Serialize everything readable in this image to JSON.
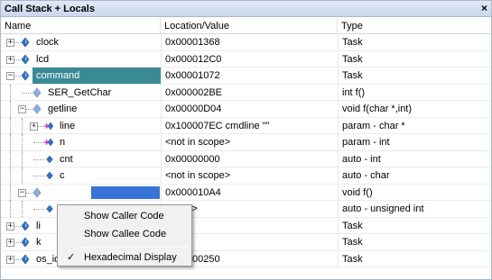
{
  "window": {
    "title": "Call Stack + Locals",
    "close_glyph": "×"
  },
  "columns": {
    "name": "Name",
    "location": "Location/Value",
    "type": "Type"
  },
  "rows": [
    {
      "name": "clock",
      "location": "0x00001368",
      "type": "Task",
      "level": 0,
      "expander": "+",
      "icon": "task-icon"
    },
    {
      "name": "lcd",
      "location": "0x000012C0",
      "type": "Task",
      "level": 0,
      "expander": "+",
      "icon": "task-icon"
    },
    {
      "name": "command",
      "location": "0x00001072",
      "type": "Task",
      "level": 0,
      "expander": "−",
      "icon": "task-icon",
      "selected": true
    },
    {
      "name": "SER_GetChar",
      "location": "0x000002BE",
      "type": "int f()",
      "level": 1,
      "icon": "function-icon"
    },
    {
      "name": "getline",
      "location": "0x00000D04",
      "type": "void f(char *,int)",
      "level": 1,
      "expander": "−",
      "icon": "function-icon"
    },
    {
      "name": "line",
      "location": "0x100007EC cmdline \"\"",
      "type": "param - char *",
      "level": 2,
      "expander": "+",
      "icon": "param-icon"
    },
    {
      "name": "n",
      "location": "<not in scope>",
      "type": "param - int",
      "level": 2,
      "icon": "param-icon"
    },
    {
      "name": "cnt",
      "location": "0x00000000",
      "type": "auto - int",
      "level": 2,
      "icon": "variable-icon"
    },
    {
      "name": "c",
      "location": "<not in scope>",
      "type": "auto - char",
      "level": 2,
      "icon": "variable-icon"
    },
    {
      "name": "",
      "location": "0x000010A4",
      "type": "void f()",
      "level": 1,
      "expander": "−",
      "icon": "function-icon",
      "partial": true
    },
    {
      "name": "",
      "location": "scope>",
      "type": "auto - unsigned int",
      "level": 2,
      "icon": "variable-icon",
      "partial": true
    },
    {
      "name": "li",
      "location": "0F1E",
      "type": "Task",
      "level": 0,
      "expander": "+",
      "icon": "task-icon",
      "partial": true
    },
    {
      "name": "k",
      "location": "0E3E",
      "type": "Task",
      "level": 0,
      "expander": "+",
      "icon": "task-icon",
      "partial": true
    },
    {
      "name": "os_idle_demon",
      "location": "0x00000250",
      "type": "Task",
      "level": 0,
      "expander": "+",
      "icon": "task-icon",
      "partial": true
    }
  ],
  "context_menu": {
    "items": [
      {
        "label": "Show Caller Code",
        "checked": false
      },
      {
        "label": "Show Callee Code",
        "checked": false
      },
      {
        "label": "Hexadecimal Display",
        "checked": true
      }
    ],
    "check_glyph": "✓"
  },
  "colors": {
    "selection": "#3a8a96",
    "title_bar": "#cfdcec",
    "task_icon": "#2f72c8",
    "param_icon": "#e040c8"
  }
}
